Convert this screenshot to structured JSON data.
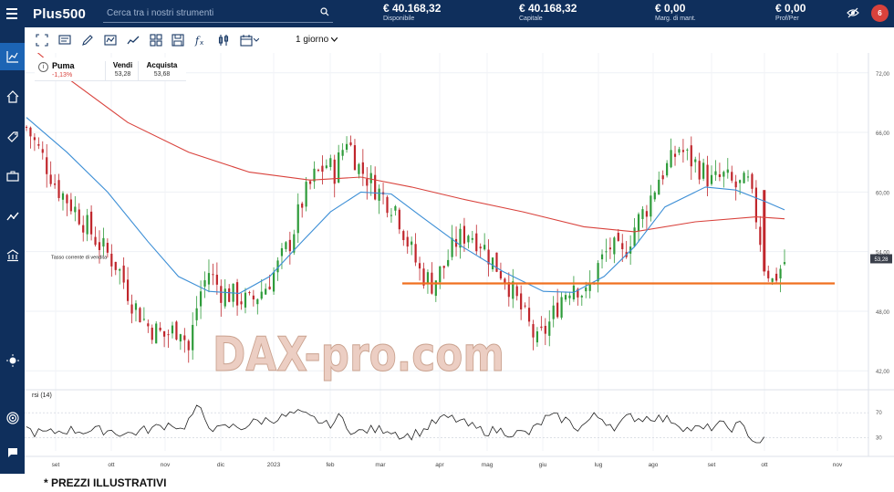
{
  "header": {
    "logo": "Plus500",
    "search_placeholder": "Cerca tra i nostri strumenti",
    "stats": [
      {
        "value": "€ 40.168,32",
        "label": "Disponibile"
      },
      {
        "value": "€ 40.168,32",
        "label": "Capitale"
      },
      {
        "value": "€ 0,00",
        "label": "Marg. di mant."
      },
      {
        "value": "€ 0,00",
        "label": "Prof/Per"
      }
    ],
    "notifications": "6"
  },
  "sidebar": {
    "items": [
      {
        "icon": "chart-line-icon",
        "active": true
      },
      {
        "icon": "house-chart-icon",
        "active": false
      },
      {
        "icon": "tag-icon",
        "active": false
      },
      {
        "icon": "briefcase-icon",
        "active": false
      },
      {
        "icon": "trend-icon",
        "active": false
      },
      {
        "icon": "bank-icon",
        "active": false
      }
    ],
    "bottom_items": [
      {
        "icon": "sun-icon"
      },
      {
        "icon": "target-icon"
      },
      {
        "icon": "chat-icon"
      }
    ]
  },
  "toolbar": {
    "icons": [
      "fullscreen-icon",
      "comment-icon",
      "pencil-icon",
      "indicator-icon",
      "line-chart-icon",
      "layout-grid-icon",
      "save-icon",
      "fx-icon",
      "candles-icon",
      "calendar-icon"
    ],
    "timeframe": "1 giorno"
  },
  "instrument": {
    "name": "Puma",
    "change": "-1,13%",
    "sell_label": "Vendi",
    "sell": "53,28",
    "buy_label": "Acquista",
    "buy": "53,68"
  },
  "chart_annotation": "Tasso corrente di vendita",
  "watermark": "DAX-pro.com",
  "rsi_label": "rsi (14)",
  "current_price_tag": "53,28",
  "disclaimer": "* PREZZI ILLUSTRATIVI",
  "colors": {
    "navy": "#0f2f5c",
    "active_blue": "#1c64b4",
    "bull": "#2e9b3a",
    "bear": "#c0262c",
    "ma_long": "#d9423c",
    "ma_short": "#3d8fd6",
    "support": "#f07020"
  },
  "chart_data": {
    "type": "candlestick",
    "price_axis": {
      "min": 40,
      "max": 74,
      "ticks": [
        "72,00",
        "66,00",
        "60,00",
        "54,00",
        "48,00",
        "42,00"
      ]
    },
    "time_axis": [
      "set",
      "ott",
      "nov",
      "dic",
      "2023",
      "feb",
      "mar",
      "apr",
      "mag",
      "giu",
      "lug",
      "ago",
      "set",
      "ott",
      "nov"
    ],
    "rsi_axis": {
      "ticks": [
        "70",
        "30"
      ]
    },
    "support_level": 50.8,
    "close_path": [
      [
        0,
        66.5
      ],
      [
        8,
        63.5
      ],
      [
        15,
        60.5
      ],
      [
        25,
        58.0
      ],
      [
        35,
        55.0
      ],
      [
        45,
        52.5
      ],
      [
        52,
        49.0
      ],
      [
        60,
        46.5
      ],
      [
        68,
        45.5
      ],
      [
        76,
        46.5
      ],
      [
        80,
        44.0
      ],
      [
        85,
        49.5
      ],
      [
        90,
        52.0
      ],
      [
        96,
        50.0
      ],
      [
        103,
        49.5
      ],
      [
        110,
        48.8
      ],
      [
        118,
        50.5
      ],
      [
        124,
        52.5
      ],
      [
        130,
        55.0
      ],
      [
        136,
        59.0
      ],
      [
        142,
        61.5
      ],
      [
        148,
        62.8
      ],
      [
        152,
        62.0
      ],
      [
        158,
        65.5
      ],
      [
        164,
        62.5
      ],
      [
        170,
        61.0
      ],
      [
        176,
        59.5
      ],
      [
        182,
        58.5
      ],
      [
        188,
        55.0
      ],
      [
        194,
        52.0
      ],
      [
        200,
        50.8
      ],
      [
        206,
        52.5
      ],
      [
        212,
        55.0
      ],
      [
        218,
        56.0
      ],
      [
        224,
        55.0
      ],
      [
        230,
        53.0
      ],
      [
        236,
        51.5
      ],
      [
        242,
        49.0
      ],
      [
        248,
        46.5
      ],
      [
        252,
        44.8
      ],
      [
        258,
        46.8
      ],
      [
        264,
        49.5
      ],
      [
        270,
        51.0
      ],
      [
        276,
        49.5
      ],
      [
        282,
        52.5
      ],
      [
        288,
        54.5
      ],
      [
        294,
        53.5
      ],
      [
        300,
        56.5
      ],
      [
        306,
        58.5
      ],
      [
        312,
        61.5
      ],
      [
        318,
        63.0
      ],
      [
        322,
        64.5
      ],
      [
        326,
        63.5
      ],
      [
        332,
        62.5
      ],
      [
        338,
        61.0
      ],
      [
        344,
        61.5
      ],
      [
        350,
        60.5
      ],
      [
        356,
        60.8
      ],
      [
        360,
        57.5
      ],
      [
        364,
        53.0
      ],
      [
        368,
        51.0
      ],
      [
        374,
        53.0
      ]
    ],
    "ma_long": [
      [
        0,
        75.0
      ],
      [
        20,
        71.5
      ],
      [
        50,
        67.0
      ],
      [
        80,
        64.0
      ],
      [
        110,
        62.0
      ],
      [
        140,
        61.2
      ],
      [
        165,
        61.5
      ],
      [
        190,
        60.5
      ],
      [
        215,
        59.3
      ],
      [
        245,
        58.0
      ],
      [
        275,
        56.5
      ],
      [
        300,
        56.0
      ],
      [
        330,
        57.0
      ],
      [
        360,
        57.5
      ],
      [
        374,
        57.3
      ]
    ],
    "ma_short": [
      [
        0,
        67.5
      ],
      [
        20,
        64.0
      ],
      [
        40,
        60.0
      ],
      [
        60,
        55.0
      ],
      [
        75,
        51.5
      ],
      [
        90,
        50.0
      ],
      [
        105,
        49.8
      ],
      [
        120,
        51.5
      ],
      [
        135,
        54.8
      ],
      [
        150,
        58.0
      ],
      [
        165,
        60.0
      ],
      [
        180,
        59.8
      ],
      [
        195,
        57.5
      ],
      [
        215,
        54.5
      ],
      [
        235,
        52.0
      ],
      [
        255,
        50.0
      ],
      [
        270,
        49.9
      ],
      [
        285,
        51.5
      ],
      [
        300,
        54.5
      ],
      [
        315,
        58.5
      ],
      [
        335,
        60.5
      ],
      [
        350,
        60.2
      ],
      [
        365,
        59.0
      ],
      [
        374,
        58.2
      ]
    ]
  }
}
